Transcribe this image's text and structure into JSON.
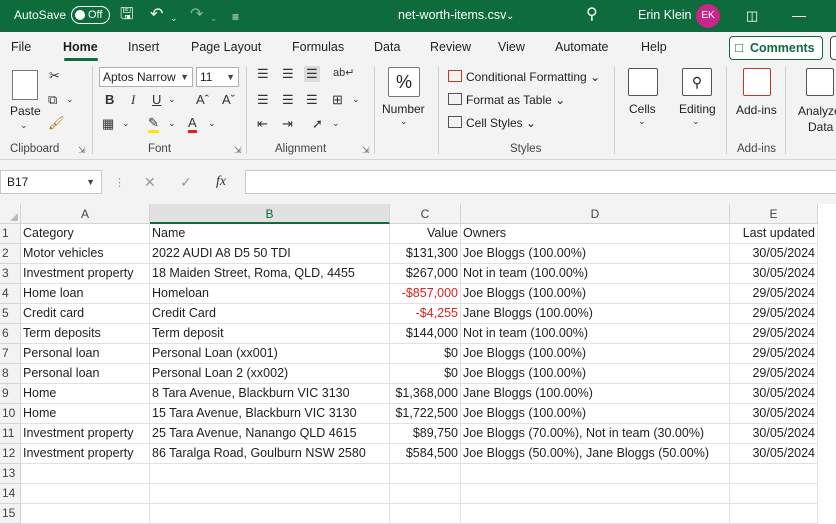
{
  "titlebar": {
    "autosave_label": "AutoSave",
    "autosave_state": "Off",
    "filename": "net-worth-items.csv",
    "user_name": "Erin Klein",
    "user_initials": "EK"
  },
  "tabs": [
    "File",
    "Home",
    "Insert",
    "Page Layout",
    "Formulas",
    "Data",
    "Review",
    "View",
    "Automate",
    "Help"
  ],
  "active_tab": "Home",
  "comments_label": "Comments",
  "ribbon": {
    "clipboard": {
      "paste_label": "Paste",
      "group_label": "Clipboard"
    },
    "font": {
      "font_name": "Aptos Narrow",
      "font_size": "11",
      "group_label": "Font"
    },
    "alignment": {
      "group_label": "Alignment"
    },
    "number": {
      "label": "Number",
      "percent_symbol": "%"
    },
    "styles": {
      "conditional_formatting": "Conditional Formatting",
      "format_as_table": "Format as Table",
      "cell_styles": "Cell Styles",
      "group_label": "Styles"
    },
    "cells": {
      "label": "Cells"
    },
    "editing": {
      "label": "Editing"
    },
    "addins": {
      "label": "Add-ins",
      "group_label": "Add-ins"
    },
    "analyze": {
      "label_line1": "Analyze",
      "label_line2": "Data"
    }
  },
  "formula_bar": {
    "cell_ref": "B17",
    "fx_label": "fx",
    "content": ""
  },
  "columns": [
    "A",
    "B",
    "C",
    "D",
    "E"
  ],
  "selected_column": "B",
  "rows": [
    [
      "Category",
      "Name",
      "Value",
      "Owners",
      "Last updated"
    ],
    [
      "Motor vehicles",
      "2022 AUDI A8 D5 50 TDI",
      "$131,300",
      "Joe Bloggs (100.00%)",
      "30/05/2024"
    ],
    [
      "Investment property",
      "18 Maiden Street, Roma, QLD, 4455",
      "$267,000",
      "Not in team (100.00%)",
      "30/05/2024"
    ],
    [
      "Home loan",
      "Homeloan",
      "-$857,000",
      "Joe Bloggs (100.00%)",
      "29/05/2024"
    ],
    [
      "Credit card",
      "Credit Card",
      "-$4,255",
      "Jane Bloggs (100.00%)",
      "29/05/2024"
    ],
    [
      "Term deposits",
      "Term deposit",
      "$144,000",
      "Not in team (100.00%)",
      "29/05/2024"
    ],
    [
      "Personal loan",
      "Personal Loan (xx001)",
      "$0",
      "Joe Bloggs (100.00%)",
      "29/05/2024"
    ],
    [
      "Personal loan",
      "Personal Loan 2 (xx002)",
      "$0",
      "Joe Bloggs (100.00%)",
      "29/05/2024"
    ],
    [
      "Home",
      "8 Tara Avenue, Blackburn VIC 3130",
      "$1,368,000",
      "Jane Bloggs (100.00%)",
      "30/05/2024"
    ],
    [
      "Home",
      "15 Tara Avenue, Blackburn VIC 3130",
      "$1,722,500",
      "Joe Bloggs (100.00%)",
      "30/05/2024"
    ],
    [
      "Investment property",
      "25 Tara Avenue, Nanango QLD 4615",
      "$89,750",
      "Joe Bloggs (70.00%), Not in team (30.00%)",
      "30/05/2024"
    ],
    [
      "Investment property",
      "86 Taralga Road, Goulburn NSW 2580",
      "$584,500",
      "Joe Bloggs (50.00%), Jane Bloggs (50.00%)",
      "30/05/2024"
    ],
    [
      "",
      "",
      "",
      "",
      ""
    ],
    [
      "",
      "",
      "",
      "",
      ""
    ],
    [
      "",
      "",
      "",
      "",
      ""
    ]
  ],
  "row_numbers": [
    "1",
    "2",
    "3",
    "4",
    "5",
    "6",
    "7",
    "8",
    "9",
    "10",
    "11",
    "12",
    "13",
    "14",
    "15"
  ],
  "colors": {
    "brand": "#0e6b3c",
    "negative": "#e0201c",
    "avatar": "#c9268a"
  }
}
